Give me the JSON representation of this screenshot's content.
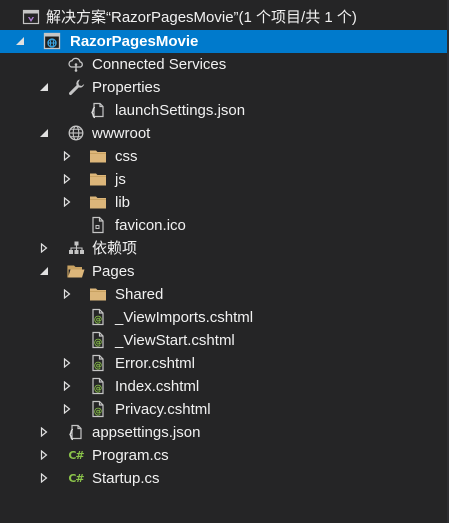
{
  "solution_explorer": {
    "items": [
      {
        "label": "解决方案“RazorPagesMovie”(1 个项目/共 1 个)",
        "icon": "solution-icon",
        "expander": "none",
        "depth": 0
      },
      {
        "label": "RazorPagesMovie",
        "icon": "web-project-icon",
        "expander": "expanded",
        "depth": 0,
        "selected": true
      },
      {
        "label": "Connected Services",
        "icon": "connected-services-icon",
        "expander": "none",
        "depth": 1
      },
      {
        "label": "Properties",
        "icon": "wrench-icon",
        "expander": "expanded",
        "depth": 1
      },
      {
        "label": "launchSettings.json",
        "icon": "json-file-icon",
        "expander": "none",
        "depth": 2
      },
      {
        "label": "wwwroot",
        "icon": "globe-icon",
        "expander": "expanded",
        "depth": 1
      },
      {
        "label": "css",
        "icon": "folder-icon",
        "expander": "collapsed",
        "depth": 2
      },
      {
        "label": "js",
        "icon": "folder-icon",
        "expander": "collapsed",
        "depth": 2
      },
      {
        "label": "lib",
        "icon": "folder-icon",
        "expander": "collapsed",
        "depth": 2
      },
      {
        "label": "favicon.ico",
        "icon": "ico-file-icon",
        "expander": "none",
        "depth": 2
      },
      {
        "label": "依赖项",
        "icon": "dependencies-icon",
        "expander": "collapsed",
        "depth": 1
      },
      {
        "label": "Pages",
        "icon": "open-folder-icon",
        "expander": "expanded",
        "depth": 1
      },
      {
        "label": "Shared",
        "icon": "folder-icon",
        "expander": "collapsed",
        "depth": 2
      },
      {
        "label": "_ViewImports.cshtml",
        "icon": "razor-file-icon",
        "expander": "none",
        "depth": 2
      },
      {
        "label": "_ViewStart.cshtml",
        "icon": "razor-file-icon",
        "expander": "none",
        "depth": 2
      },
      {
        "label": "Error.cshtml",
        "icon": "razor-file-icon",
        "expander": "collapsed",
        "depth": 2
      },
      {
        "label": "Index.cshtml",
        "icon": "razor-file-icon",
        "expander": "collapsed",
        "depth": 2
      },
      {
        "label": "Privacy.cshtml",
        "icon": "razor-file-icon",
        "expander": "collapsed",
        "depth": 2
      },
      {
        "label": "appsettings.json",
        "icon": "json-file-icon",
        "expander": "collapsed",
        "depth": 1
      },
      {
        "label": "Program.cs",
        "icon": "csharp-file-icon",
        "expander": "collapsed",
        "depth": 1
      },
      {
        "label": "Startup.cs",
        "icon": "csharp-file-icon",
        "expander": "collapsed",
        "depth": 1
      }
    ]
  },
  "colors": {
    "background": "#252526",
    "selected_background": "#007acc",
    "text": "#f1f1f1",
    "folder": "#dcb67a",
    "csharp": "#8bc34a"
  }
}
